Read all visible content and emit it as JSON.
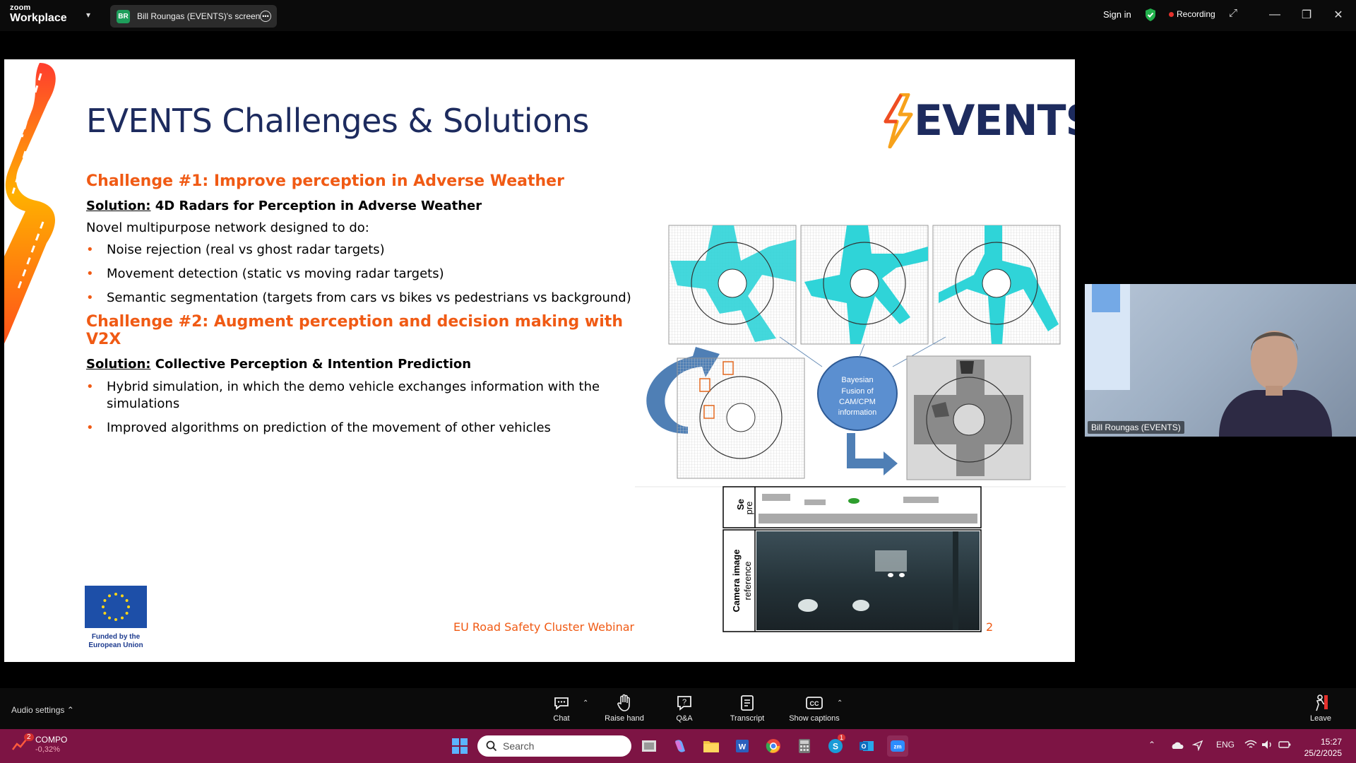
{
  "titlebar": {
    "logo_small": "zoom",
    "logo_big": "Workplace",
    "share_initials": "BR",
    "share_label": "Bill Roungas (EVENTS)'s screen",
    "sign_in": "Sign in",
    "recording": "Recording"
  },
  "slide": {
    "title": "EVENTS Challenges & Solutions",
    "brand": "EVENTS",
    "challenge1": "Challenge #1: Improve perception in Adverse Weather",
    "solution1_label": "Solution:",
    "solution1_text": "4D Radars for Perception in Adverse Weather",
    "intro": "Novel multipurpose network designed to do:",
    "bullets1": [
      "Noise rejection (real vs ghost radar targets)",
      "Movement detection (static vs moving radar targets)",
      "Semantic segmentation (targets from cars vs bikes vs pedestrians vs background)"
    ],
    "challenge2": "Challenge #2: Augment perception and decision making with V2X",
    "solution2_label": "Solution:",
    "solution2_text": "Collective Perception & Intention Prediction",
    "bullets2": [
      "Hybrid simulation, in which the demo vehicle exchanges information with the simulations",
      "Improved algorithms on prediction of the movement of other vehicles"
    ],
    "fusion_lines": [
      "Bayesian",
      "Fusion of",
      "CAM/CPM",
      "information"
    ],
    "panel_label_top": "Se",
    "panel_label_top2": "pre",
    "camera_label_1": "Camera image",
    "camera_label_2": "reference",
    "funded_1": "Funded by the",
    "funded_2": "European Union",
    "footer": "EU Road Safety Cluster Webinar",
    "page": "2"
  },
  "participant": {
    "name": "Bill Roungas (EVENTS)"
  },
  "controls": {
    "audio": "Audio settings",
    "items": [
      "Chat",
      "Raise hand",
      "Q&A",
      "Transcript",
      "Show captions"
    ],
    "leave": "Leave"
  },
  "taskbar": {
    "stock_badge": "2",
    "stock_name": "COMPO",
    "stock_change": "-0,32%",
    "search_placeholder": "Search",
    "skype_badge": "1",
    "lang": "ENG",
    "time": "15:27",
    "date": "25/2/2025"
  },
  "colors": {
    "accent_orange": "#f05a14",
    "navy": "#1d2b5e",
    "taskbar": "#7d1444",
    "cyan": "#2fd4d8"
  }
}
